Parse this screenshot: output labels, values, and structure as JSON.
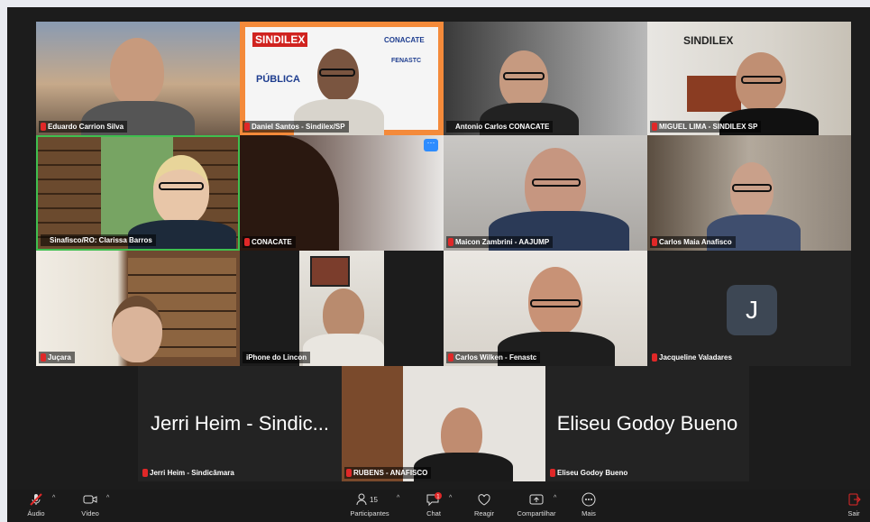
{
  "participants": [
    {
      "name": "Eduardo Carrion Silva"
    },
    {
      "name": "Daniel Santos - Sindilex/SP"
    },
    {
      "name": "Antonio Carlos CONACATE"
    },
    {
      "name": "MIGUEL LIMA - SINDILEX SP"
    },
    {
      "name": "Sinafisco/RO: Clarissa Barros"
    },
    {
      "name": "CONACATE"
    },
    {
      "name": "Maicon Zambrini - AAJUMP"
    },
    {
      "name": "Carlos Maia Anafisco"
    },
    {
      "name": "Juçara"
    },
    {
      "name": "iPhone do Lincon"
    },
    {
      "name": "Carlos Wilken - Fenastc"
    },
    {
      "name": "Jacqueline Valadares",
      "initial": "J"
    },
    {
      "name": "Jerri Heim - Sindicâmara",
      "display": "Jerri Heim - Sindic..."
    },
    {
      "name": "RUBENS - ANAFISCO"
    },
    {
      "name": "Eliseu Godoy Bueno",
      "display": "Eliseu Godoy Bueno"
    }
  ],
  "banner": {
    "sindilex": "SINDILEX",
    "conacate": "CONACATE",
    "fenastc": "FENASTC",
    "publica": "PÚBLICA",
    "sindilex_wall": "SINDILEX"
  },
  "toolbar": {
    "audio": "Áudio",
    "video": "Vídeo",
    "participants": "Participantes",
    "participants_count": "15",
    "chat": "Chat",
    "chat_badge": "1",
    "react": "Reagir",
    "share": "Compartilhar",
    "more": "Mais",
    "leave": "Sair"
  },
  "colors": {
    "active_speaker_border": "#3fbf4f",
    "mute_icon": "#e02828",
    "toolbar_bg": "#1a1a1a"
  }
}
